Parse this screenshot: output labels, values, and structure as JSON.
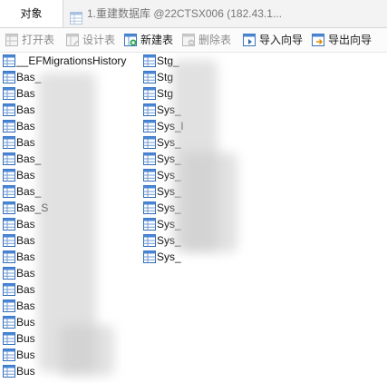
{
  "tabs": {
    "objects_label": "对象",
    "db_tab_label": "1.重建数据库 @22CTSX006 (182.43.1..."
  },
  "toolbar": {
    "open_table": "打开表",
    "design_table": "设计表",
    "new_table": "新建表",
    "delete_table": "删除表",
    "import_wizard": "导入向导",
    "export_wizard": "导出向导"
  },
  "tables": {
    "left": [
      "__EFMigrationsHistory",
      "Bas_",
      "Bas",
      "Bas",
      "Bas",
      "Bas",
      "Bas_",
      "Bas",
      "Bas_",
      "Bas_S",
      "Bas",
      "Bas",
      "Bas",
      "Bas",
      "Bas",
      "Bas",
      "Bus",
      "Bus",
      "Bus",
      "Bus"
    ],
    "right": [
      "Stg_",
      "Stg",
      "Stg",
      "Sys_",
      "Sys_l",
      "Sys_",
      "Sys_",
      "Sys_",
      "Sys_",
      "Sys_",
      "Sys_",
      "Sys_",
      "Sys_"
    ]
  },
  "colors": {
    "icon_blue": "#2e6bb8",
    "icon_header": "#4a86d4",
    "disabled_text": "#8c8c8c"
  }
}
